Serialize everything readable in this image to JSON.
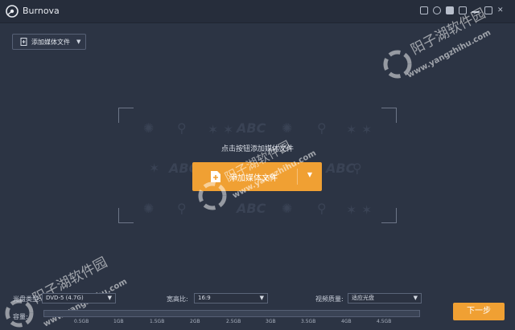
{
  "app": {
    "title": "Burnova"
  },
  "toolbar": {
    "add_media_label": "添加媒体文件"
  },
  "drop_area": {
    "hint": "点击按钮添加媒体文件",
    "add_button_label": "添加媒体文件",
    "decor_text": "ABC"
  },
  "settings": {
    "disc_type": {
      "label": "光盘类型:",
      "value": "DVD-5 (4.7G)"
    },
    "aspect_ratio": {
      "label": "宽高比:",
      "value": "16:9"
    },
    "video_quality": {
      "label": "视频质量:",
      "value": "适应光盘"
    }
  },
  "capacity": {
    "label": "容量:",
    "ticks": [
      "0.5GB",
      "1GB",
      "1.5GB",
      "2GB",
      "2.5GB",
      "3GB",
      "3.5GB",
      "4GB",
      "4.5GB"
    ],
    "used_fraction": 0
  },
  "next_button_label": "下一步",
  "watermark": {
    "text": "阳子湖软件园",
    "url": "www.yangzhihu.com"
  },
  "colors": {
    "accent": "#f0a033",
    "background": "#2c3444",
    "titlebar": "#262d3b"
  }
}
